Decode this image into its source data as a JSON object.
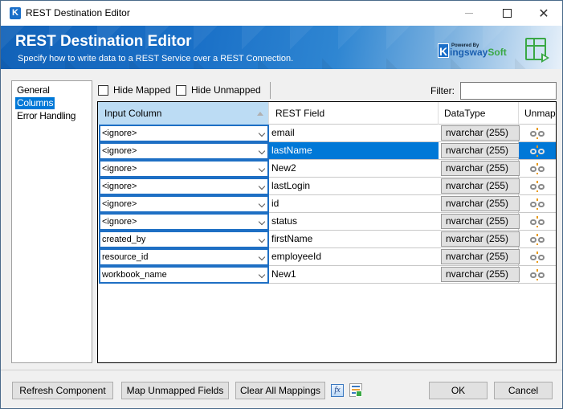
{
  "window": {
    "title": "REST Destination Editor",
    "app_icon_letter": "K",
    "minimize_label": "",
    "close_glyph": "✕"
  },
  "banner": {
    "title": "REST Destination Editor",
    "subtitle": "Specify how to write data to a REST Service over a REST Connection.",
    "logo": {
      "k": "K",
      "powered_by": "Powered By",
      "ings": "ingsway",
      "soft": "Soft"
    },
    "colors": {
      "banner": "#1a70c7",
      "brand_green": "#3aa845"
    }
  },
  "nav": {
    "items": [
      {
        "label": "General",
        "selected": false
      },
      {
        "label": "Columns",
        "selected": true
      },
      {
        "label": "Error Handling",
        "selected": false
      }
    ]
  },
  "toolbar": {
    "hide_mapped_label": "Hide Mapped",
    "hide_mapped_checked": false,
    "hide_unmapped_label": "Hide Unmapped",
    "hide_unmapped_checked": false,
    "filter_label": "Filter:",
    "filter_value": ""
  },
  "grid": {
    "headers": {
      "input_column": "Input Column",
      "rest_field": "REST Field",
      "data_type": "DataType",
      "unmap": "Unmap"
    },
    "sorted_column": "input_column",
    "selected_row": 1,
    "rows": [
      {
        "input": "<ignore>",
        "rest_field": "email",
        "data_type": "nvarchar (255)"
      },
      {
        "input": "<ignore>",
        "rest_field": "lastName",
        "data_type": "nvarchar (255)"
      },
      {
        "input": "<ignore>",
        "rest_field": "New2",
        "data_type": "nvarchar (255)"
      },
      {
        "input": "<ignore>",
        "rest_field": "lastLogin",
        "data_type": "nvarchar (255)"
      },
      {
        "input": "<ignore>",
        "rest_field": "id",
        "data_type": "nvarchar (255)"
      },
      {
        "input": "<ignore>",
        "rest_field": "status",
        "data_type": "nvarchar (255)"
      },
      {
        "input": "created_by",
        "rest_field": "firstName",
        "data_type": "nvarchar (255)"
      },
      {
        "input": "resource_id",
        "rest_field": "employeeId",
        "data_type": "nvarchar (255)"
      },
      {
        "input": "workbook_name",
        "rest_field": "New1",
        "data_type": "nvarchar (255)"
      }
    ]
  },
  "buttons": {
    "refresh": "Refresh Component",
    "map_unmapped": "Map Unmapped Fields",
    "clear_all": "Clear All Mappings",
    "fx": "fx",
    "ok": "OK",
    "cancel": "Cancel"
  }
}
